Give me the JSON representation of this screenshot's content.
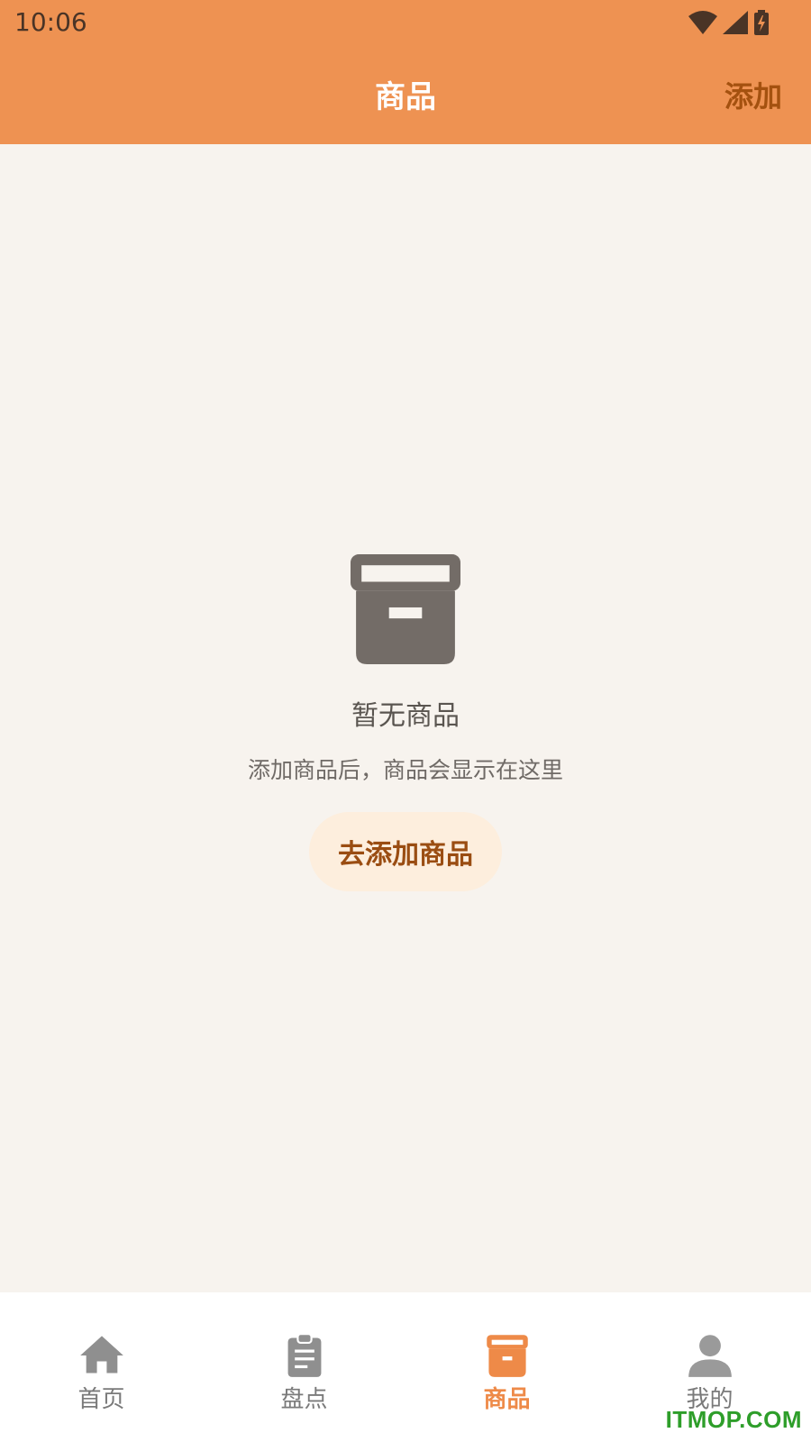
{
  "status_bar": {
    "time": "10:06",
    "icons": [
      "wifi-icon",
      "cellular-signal-icon",
      "battery-charging-icon"
    ],
    "color": "#4a3426"
  },
  "header": {
    "title": "商品",
    "action_label": "添加",
    "background": "#ee9252",
    "action_color": "#a4510f"
  },
  "empty_state": {
    "icon": "archive-box-icon",
    "title": "暂无商品",
    "subtitle": "添加商品后，商品会显示在这里",
    "button_label": "去添加商品",
    "button_background": "#fdeedd",
    "button_color": "#9a4d12"
  },
  "tabbar": {
    "items": [
      {
        "label": "首页",
        "icon": "home-icon",
        "active": false
      },
      {
        "label": "盘点",
        "icon": "clipboard-icon",
        "active": false
      },
      {
        "label": "商品",
        "icon": "archive-box-icon",
        "active": true
      },
      {
        "label": "我的",
        "icon": "person-icon",
        "active": false
      }
    ],
    "active_color": "#ee8a48",
    "inactive_color": "#8f8f8f"
  },
  "watermark": "ITMOP.COM",
  "page_background": "#f7f3ee"
}
